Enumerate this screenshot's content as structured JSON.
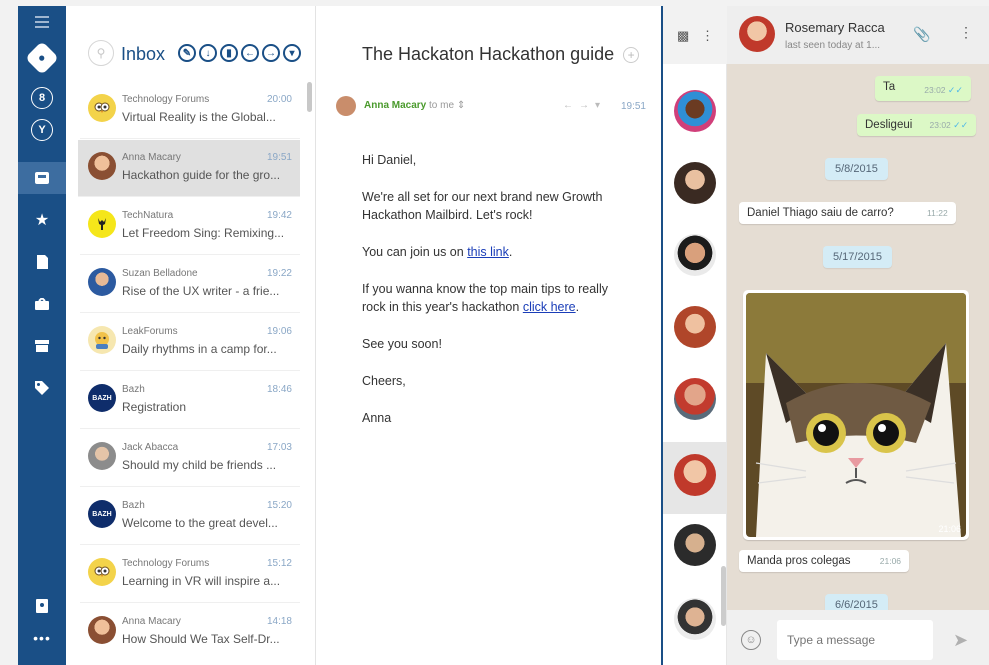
{
  "mail": {
    "inbox_label": "Inbox",
    "list": [
      {
        "from": "Technology Forums",
        "time": "20:00",
        "subject": "Virtual Reality is the Global...",
        "avatar": "owl-icon",
        "avatar_color": "#f3d34a"
      },
      {
        "from": "Anna Macary",
        "time": "19:51",
        "subject": "Hackathon guide for the gro...",
        "avatar": "person-photo",
        "avatar_color": "#b3775a",
        "selected": true
      },
      {
        "from": "TechNatura",
        "time": "19:42",
        "subject": "Let Freedom Sing: Remixing...",
        "avatar": "deer-icon",
        "avatar_color": "#f5e61a"
      },
      {
        "from": "Suzan Belladone",
        "time": "19:22",
        "subject": "Rise of the UX writer - a frie...",
        "avatar": "person-photo",
        "avatar_color": "#2c5aa0"
      },
      {
        "from": "LeakForums",
        "time": "19:06",
        "subject": "Daily rhythms in a camp for...",
        "avatar": "mascot-icon",
        "avatar_color": "#f1c24a"
      },
      {
        "from": "Bazh",
        "time": "18:46",
        "subject": "Registration",
        "avatar": "bazh-logo",
        "avatar_color": "#0f2d6b"
      },
      {
        "from": "Jack Abacca",
        "time": "17:03",
        "subject": "Should my child be friends ...",
        "avatar": "person-photo",
        "avatar_color": "#9a9a9a"
      },
      {
        "from": "Bazh",
        "time": "15:20",
        "subject": "Welcome to the great devel...",
        "avatar": "bazh-logo",
        "avatar_color": "#0f2d6b"
      },
      {
        "from": "Technology Forums",
        "time": "15:12",
        "subject": "Learning in VR will inspire a...",
        "avatar": "owl-icon",
        "avatar_color": "#f3d34a"
      },
      {
        "from": "Anna Macary",
        "time": "14:18",
        "subject": "How Should We Tax Self-Dr...",
        "avatar": "person-photo",
        "avatar_color": "#b3775a"
      }
    ]
  },
  "reader": {
    "title": "The Hackaton Hackathon guide",
    "sender": "Anna Macary",
    "to": "to me",
    "time": "19:51",
    "greeting": "Hi Daniel,",
    "para1": "We're all set for our next brand new Growth Hackathon Mailbird. Let's rock!",
    "para2_pre": "You can join us on ",
    "para2_link": "this link",
    "para2_post": ".",
    "para3_pre": "If you wanna know the top main tips to really rock in this year's hackathon ",
    "para3_link": "click here",
    "para3_post": ".",
    "see_you": "See you soon!",
    "cheers": "Cheers,",
    "signature": "Anna"
  },
  "chat": {
    "contact_name": "Rosemary Racca",
    "last_seen": "last seen today at 1...",
    "messages": [
      {
        "text": "Ta",
        "time": "23:02"
      },
      {
        "text": "Desligeui",
        "time": "23:02"
      },
      {
        "date": "5/8/2015"
      },
      {
        "text": "Daniel Thiago saiu de carro?",
        "time": "11:22"
      },
      {
        "date": "5/17/2015"
      },
      {
        "photo_time": "21:06"
      },
      {
        "text": "Manda pros colegas",
        "time": "21:06"
      },
      {
        "date": "6/6/2015"
      }
    ],
    "placeholder": "Type a message"
  },
  "colors": {
    "nav": "#1a4f86",
    "accent_green": "#4a9a2c",
    "outgoing_bubble": "#dcf8c6",
    "chat_bg": "#e5ddd3"
  }
}
